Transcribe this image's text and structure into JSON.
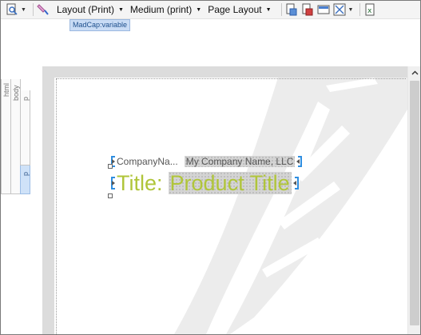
{
  "toolbar": {
    "layout_label": "Layout (Print)",
    "medium_label": "Medium (print)",
    "page_layout_label": "Page Layout"
  },
  "tooltip": "MadCap:variable",
  "structure_bars": {
    "html": "html",
    "body": "body",
    "p1": "p",
    "p2": "p"
  },
  "content": {
    "company_label": "CompanyNa...",
    "company_value": "My Company Name, LLC",
    "title_label": "Title:",
    "title_value": "Product Title"
  },
  "colors": {
    "accent_title": "#b0c53a",
    "bracket_blue": "#2f8ee0",
    "tooltip_bg": "#c9dcf5"
  }
}
